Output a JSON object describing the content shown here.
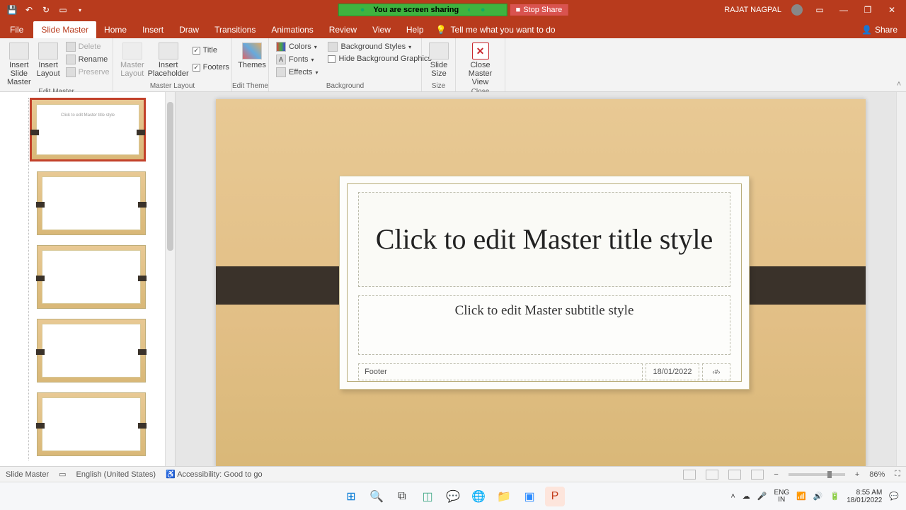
{
  "user": "RAJAT NAGPAL",
  "sharing_text": "You are screen sharing",
  "stop_share": "Stop Share",
  "tabs": {
    "file": "File",
    "slide_master": "Slide Master",
    "home": "Home",
    "insert": "Insert",
    "draw": "Draw",
    "transitions": "Transitions",
    "animations": "Animations",
    "review": "Review",
    "view": "View",
    "help": "Help",
    "tell_me": "Tell me what you want to do",
    "share": "Share"
  },
  "ribbon": {
    "edit_master": {
      "insert_slide_master": "Insert Slide\nMaster",
      "insert_layout": "Insert\nLayout",
      "delete": "Delete",
      "rename": "Rename",
      "preserve": "Preserve",
      "label": "Edit Master"
    },
    "master_layout": {
      "master_layout": "Master\nLayout",
      "insert_placeholder": "Insert\nPlaceholder",
      "title": "Title",
      "footers": "Footers",
      "label": "Master Layout"
    },
    "edit_theme": {
      "themes": "Themes",
      "label": "Edit Theme"
    },
    "background": {
      "colors": "Colors",
      "fonts": "Fonts",
      "effects": "Effects",
      "bg_styles": "Background Styles",
      "hide_bg": "Hide Background Graphics",
      "label": "Background"
    },
    "size": {
      "slide_size": "Slide\nSize",
      "label": "Size"
    },
    "close": {
      "close_master": "Close\nMaster View",
      "label": "Close"
    }
  },
  "slide": {
    "title": "Click to edit Master title style",
    "subtitle": "Click to edit Master subtitle style",
    "footer": "Footer",
    "date": "18/01/2022",
    "slidenum": "‹#›"
  },
  "status": {
    "mode": "Slide Master",
    "lang": "English (United States)",
    "access": "Accessibility: Good to go",
    "zoom": "86%"
  },
  "tray": {
    "lang1": "ENG",
    "lang2": "IN",
    "time": "8:55 AM",
    "date": "18/01/2022"
  }
}
